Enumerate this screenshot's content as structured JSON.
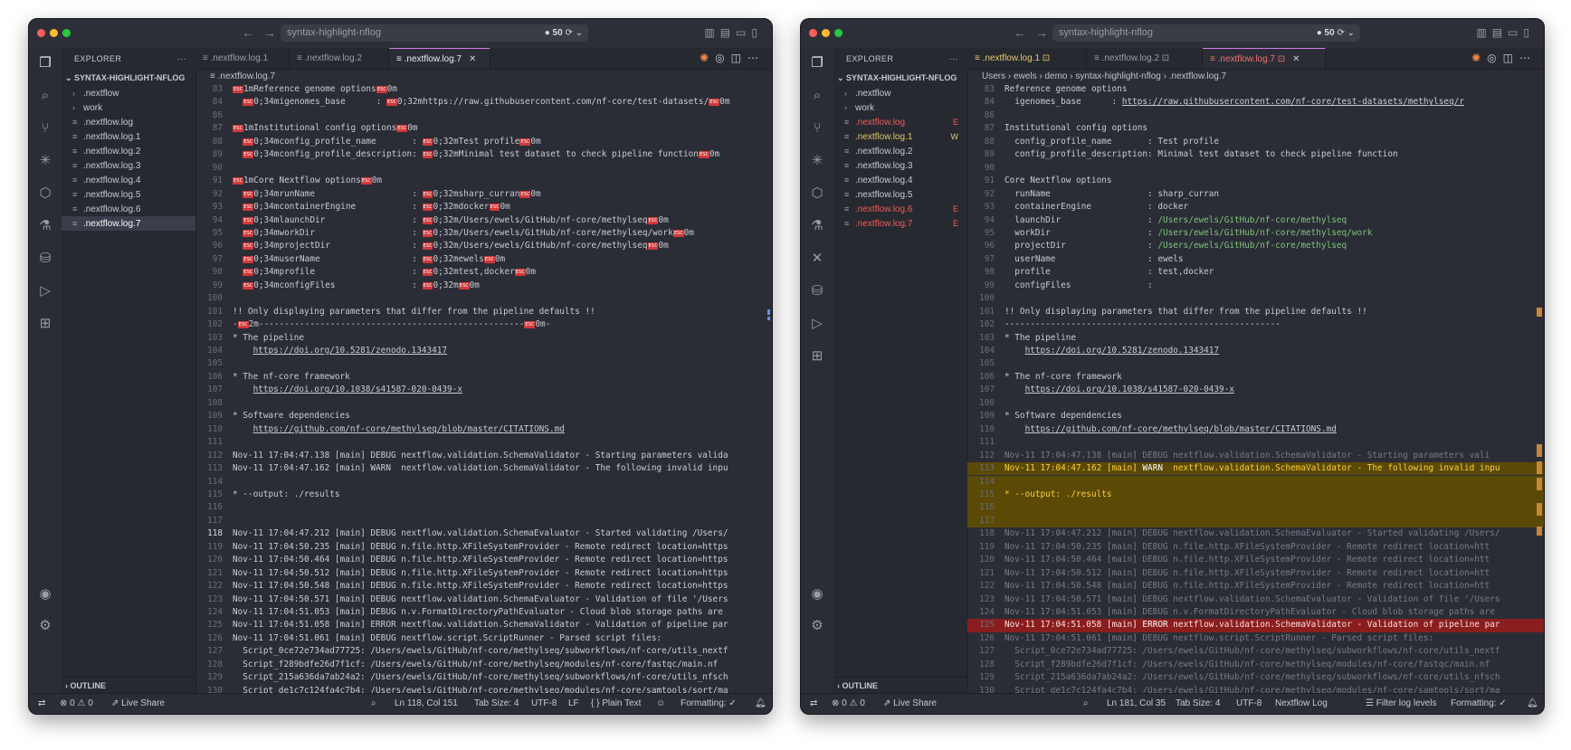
{
  "left": {
    "title": "syntax-highlight-nflog",
    "count": "50",
    "sidebar": {
      "header": "EXPLORER",
      "root": "SYNTAX-HIGHLIGHT-NFLOG",
      "items": [
        {
          "label": ".nextflow",
          "kind": "folder",
          "badge": ""
        },
        {
          "label": "work",
          "kind": "folder",
          "badge": ""
        },
        {
          "label": ".nextflow.log",
          "kind": "file",
          "badge": ""
        },
        {
          "label": ".nextflow.log.1",
          "kind": "file",
          "badge": ""
        },
        {
          "label": ".nextflow.log.2",
          "kind": "file",
          "badge": ""
        },
        {
          "label": ".nextflow.log.3",
          "kind": "file",
          "badge": ""
        },
        {
          "label": ".nextflow.log.4",
          "kind": "file",
          "badge": ""
        },
        {
          "label": ".nextflow.log.5",
          "kind": "file",
          "badge": ""
        },
        {
          "label": ".nextflow.log.6",
          "kind": "file",
          "badge": ""
        },
        {
          "label": ".nextflow.log.7",
          "kind": "file",
          "badge": ""
        }
      ],
      "outline": "OUTLINE"
    },
    "tabs": [
      ".nextflow.log.1",
      ".nextflow.log.2",
      ".nextflow.log.7"
    ],
    "breadcrumb": ".nextflow.log.7",
    "status": {
      "errors": "0",
      "warnings": "0",
      "live_share": "Live Share",
      "position": "Ln 118, Col 151",
      "tab_size": "Tab Size: 4",
      "encoding": "UTF-8",
      "eol": "LF",
      "language": "{ } Plain Text",
      "formatting": "Formatting: ✓"
    },
    "lines": [
      {
        "n": "83",
        "t": "⟪1mReference genome options⟪0m"
      },
      {
        "n": "84",
        "t": "  ⟪0;34migenomes_base      : ⟪0;32mhttps://raw.githubusercontent.com/nf-core/test-datasets/⟪0m"
      },
      {
        "n": "86",
        "t": ""
      },
      {
        "n": "87",
        "t": "⟪1mInstitutional config options⟪0m"
      },
      {
        "n": "88",
        "t": "  ⟪0;34mconfig_profile_name       : ⟪0;32mTest profile⟪0m"
      },
      {
        "n": "89",
        "t": "  ⟪0;34mconfig_profile_description: ⟪0;32mMinimal test dataset to check pipeline function⟪0m"
      },
      {
        "n": "90",
        "t": ""
      },
      {
        "n": "91",
        "t": "⟪1mCore Nextflow options⟪0m"
      },
      {
        "n": "92",
        "t": "  ⟪0;34mrunName                   : ⟪0;32msharp_curran⟪0m"
      },
      {
        "n": "93",
        "t": "  ⟪0;34mcontainerEngine           : ⟪0;32mdocker⟪0m"
      },
      {
        "n": "94",
        "t": "  ⟪0;34mlaunchDir                 : ⟪0;32m/Users/ewels/GitHub/nf-core/methylseq⟪0m"
      },
      {
        "n": "95",
        "t": "  ⟪0;34mworkDir                   : ⟪0;32m/Users/ewels/GitHub/nf-core/methylseq/work⟪0m"
      },
      {
        "n": "96",
        "t": "  ⟪0;34mprojectDir                : ⟪0;32m/Users/ewels/GitHub/nf-core/methylseq⟪0m"
      },
      {
        "n": "97",
        "t": "  ⟪0;34muserName                  : ⟪0;32mewels⟪0m"
      },
      {
        "n": "98",
        "t": "  ⟪0;34mprofile                   : ⟪0;32mtest,docker⟪0m"
      },
      {
        "n": "99",
        "t": "  ⟪0;34mconfigFiles               : ⟪0;32m⟪0m"
      },
      {
        "n": "100",
        "t": ""
      },
      {
        "n": "101",
        "t": "!! Only displaying parameters that differ from the pipeline defaults !!"
      },
      {
        "n": "102",
        "t": "-⟪2m----------------------------------------------------⟪0m-"
      },
      {
        "n": "103",
        "t": "* The pipeline"
      },
      {
        "n": "104",
        "t": "    https://doi.org/10.5281/zenodo.1343417"
      },
      {
        "n": "105",
        "t": ""
      },
      {
        "n": "106",
        "t": "* The nf-core framework"
      },
      {
        "n": "107",
        "t": "    https://doi.org/10.1038/s41587-020-0439-x"
      },
      {
        "n": "108",
        "t": ""
      },
      {
        "n": "109",
        "t": "* Software dependencies"
      },
      {
        "n": "110",
        "t": "    https://github.com/nf-core/methylseq/blob/master/CITATIONS.md"
      },
      {
        "n": "111",
        "t": ""
      },
      {
        "n": "112",
        "t": "Nov-11 17:04:47.138 [main] DEBUG nextflow.validation.SchemaValidator - Starting parameters valida"
      },
      {
        "n": "113",
        "t": "Nov-11 17:04:47.162 [main] WARN  nextflow.validation.SchemaValidator - The following invalid inpu"
      },
      {
        "n": "114",
        "t": ""
      },
      {
        "n": "115",
        "t": "* --output: ./results"
      },
      {
        "n": "116",
        "t": ""
      },
      {
        "n": "117",
        "t": ""
      },
      {
        "n": "118",
        "t": "Nov-11 17:04:47.212 [main] DEBUG nextflow.validation.SchemaEvaluator - Started validating /Users/"
      },
      {
        "n": "119",
        "t": "Nov-11 17:04:50.235 [main] DEBUG n.file.http.XFileSystemProvider - Remote redirect location=https"
      },
      {
        "n": "120",
        "t": "Nov-11 17:04:50.464 [main] DEBUG n.file.http.XFileSystemProvider - Remote redirect location=https"
      },
      {
        "n": "121",
        "t": "Nov-11 17:04:50.512 [main] DEBUG n.file.http.XFileSystemProvider - Remote redirect location=https"
      },
      {
        "n": "122",
        "t": "Nov-11 17:04:50.548 [main] DEBUG n.file.http.XFileSystemProvider - Remote redirect location=https"
      },
      {
        "n": "123",
        "t": "Nov-11 17:04:50.571 [main] DEBUG nextflow.validation.SchemaEvaluator - Validation of file '/Users"
      },
      {
        "n": "124",
        "t": "Nov-11 17:04:51.053 [main] DEBUG n.v.FormatDirectoryPathEvaluator - Cloud blob storage paths are"
      },
      {
        "n": "125",
        "t": "Nov-11 17:04:51.058 [main] ERROR nextflow.validation.SchemaValidator - Validation of pipeline par"
      },
      {
        "n": "126",
        "t": "Nov-11 17:04:51.061 [main] DEBUG nextflow.script.ScriptRunner - Parsed script files:"
      },
      {
        "n": "127",
        "t": "  Script_0ce72e734ad77725: /Users/ewels/GitHub/nf-core/methylseq/subworkflows/nf-core/utils_nextf"
      },
      {
        "n": "128",
        "t": "  Script_f289bdfe26d7f1cf: /Users/ewels/GitHub/nf-core/methylseq/modules/nf-core/fastqc/main.nf"
      },
      {
        "n": "129",
        "t": "  Script_215a636da7ab24a2: /Users/ewels/GitHub/nf-core/methylseq/subworkflows/nf-core/utils_nfsch"
      },
      {
        "n": "130",
        "t": "  Script_de1c7c124fa4c7b4: /Users/ewels/GitHub/nf-core/methylseq/modules/nf-core/samtools/sort/ma"
      }
    ]
  },
  "right": {
    "title": "syntax-highlight-nflog",
    "count": "50",
    "sidebar": {
      "header": "EXPLORER",
      "root": "SYNTAX-HIGHLIGHT-NFLOG",
      "items": [
        {
          "label": ".nextflow",
          "kind": "folder",
          "badge": ""
        },
        {
          "label": "work",
          "kind": "folder",
          "badge": ""
        },
        {
          "label": ".nextflow.log",
          "kind": "err",
          "badge": "E"
        },
        {
          "label": ".nextflow.log.1",
          "kind": "warn",
          "badge": "W"
        },
        {
          "label": ".nextflow.log.2",
          "kind": "file",
          "badge": ""
        },
        {
          "label": ".nextflow.log.3",
          "kind": "file",
          "badge": ""
        },
        {
          "label": ".nextflow.log.4",
          "kind": "file",
          "badge": ""
        },
        {
          "label": ".nextflow.log.5",
          "kind": "file",
          "badge": ""
        },
        {
          "label": ".nextflow.log.6",
          "kind": "err",
          "badge": "E"
        },
        {
          "label": ".nextflow.log.7",
          "kind": "err",
          "badge": "E"
        }
      ],
      "outline": "OUTLINE"
    },
    "tabs": [
      ".nextflow.log.1",
      ".nextflow.log.2",
      ".nextflow.log.7"
    ],
    "breadcrumb": "Users › ewels › demo › syntax-highlight-nflog › .nextflow.log.7",
    "status": {
      "errors": "0",
      "warnings": "0",
      "live_share": "Live Share",
      "position": "Ln 181, Col 35",
      "tab_size": "Tab Size: 4",
      "encoding": "UTF-8",
      "language": "Nextflow Log",
      "filter": "Filter log levels",
      "formatting": "Formatting: ✓"
    },
    "lines": [
      {
        "n": "83",
        "t": "Reference genome options"
      },
      {
        "n": "84",
        "t": "  igenomes_base      : https://raw.githubusercontent.com/nf-core/test-datasets/methylseq/r"
      },
      {
        "n": "86",
        "t": ""
      },
      {
        "n": "87",
        "t": "Institutional config options"
      },
      {
        "n": "88",
        "t": "  config_profile_name       : Test profile"
      },
      {
        "n": "89",
        "t": "  config_profile_description: Minimal test dataset to check pipeline function"
      },
      {
        "n": "90",
        "t": ""
      },
      {
        "n": "91",
        "t": "Core Nextflow options"
      },
      {
        "n": "92",
        "t": "  runName                   : sharp_curran"
      },
      {
        "n": "93",
        "t": "  containerEngine           : docker"
      },
      {
        "n": "94",
        "t": "  launchDir                 : /Users/ewels/GitHub/nf-core/methylseq"
      },
      {
        "n": "95",
        "t": "  workDir                   : /Users/ewels/GitHub/nf-core/methylseq/work"
      },
      {
        "n": "96",
        "t": "  projectDir                : /Users/ewels/GitHub/nf-core/methylseq"
      },
      {
        "n": "97",
        "t": "  userName                  : ewels"
      },
      {
        "n": "98",
        "t": "  profile                   : test,docker"
      },
      {
        "n": "99",
        "t": "  configFiles               :"
      },
      {
        "n": "100",
        "t": ""
      },
      {
        "n": "101",
        "t": "!! Only displaying parameters that differ from the pipeline defaults !!"
      },
      {
        "n": "102",
        "t": "------------------------------------------------------"
      },
      {
        "n": "103",
        "t": "* The pipeline"
      },
      {
        "n": "104",
        "t": "    https://doi.org/10.5281/zenodo.1343417"
      },
      {
        "n": "105",
        "t": ""
      },
      {
        "n": "106",
        "t": "* The nf-core framework"
      },
      {
        "n": "107",
        "t": "    https://doi.org/10.1038/s41587-020-0439-x"
      },
      {
        "n": "108",
        "t": ""
      },
      {
        "n": "109",
        "t": "* Software dependencies"
      },
      {
        "n": "110",
        "t": "    https://github.com/nf-core/methylseq/blob/master/CITATIONS.md"
      },
      {
        "n": "111",
        "t": ""
      },
      {
        "n": "112",
        "t": "Nov-11 17:04:47.138 [main] DEBUG nextflow.validation.SchemaValidator - Starting parameters vali"
      },
      {
        "n": "113",
        "t": "Nov-11 17:04:47.162 [main] WARN  nextflow.validation.SchemaValidator - The following invalid inpu"
      },
      {
        "n": "114",
        "t": ""
      },
      {
        "n": "115",
        "t": "* --output: ./results"
      },
      {
        "n": "116",
        "t": ""
      },
      {
        "n": "117",
        "t": ""
      },
      {
        "n": "118",
        "t": "Nov-11 17:04:47.212 [main] DEBUG nextflow.validation.SchemaEvaluator - Started validating /Users/"
      },
      {
        "n": "119",
        "t": "Nov-11 17:04:50.235 [main] DEBUG n.file.http.XFileSystemProvider - Remote redirect location=htt"
      },
      {
        "n": "120",
        "t": "Nov-11 17:04:50.464 [main] DEBUG n.file.http.XFileSystemProvider - Remote redirect location=htt"
      },
      {
        "n": "121",
        "t": "Nov-11 17:04:50.512 [main] DEBUG n.file.http.XFileSystemProvider - Remote redirect location=htt"
      },
      {
        "n": "122",
        "t": "Nov-11 17:04:50.548 [main] DEBUG n.file.http.XFileSystemProvider - Remote redirect location=htt"
      },
      {
        "n": "123",
        "t": "Nov-11 17:04:50.571 [main] DEBUG nextflow.validation.SchemaEvaluator - Validation of file '/Users"
      },
      {
        "n": "124",
        "t": "Nov-11 17:04:51.053 [main] DEBUG n.v.FormatDirectoryPathEvaluator - Cloud blob storage paths are"
      },
      {
        "n": "125",
        "t": "Nov-11 17:04:51.058 [main] ERROR nextflow.validation.SchemaValidator - Validation of pipeline par"
      },
      {
        "n": "126",
        "t": "Nov-11 17:04:51.061 [main] DEBUG nextflow.script.ScriptRunner - Parsed script files:"
      },
      {
        "n": "127",
        "t": "  Script_0ce72e734ad77725: /Users/ewels/GitHub/nf-core/methylseq/subworkflows/nf-core/utils_nextf"
      },
      {
        "n": "128",
        "t": "  Script_f289bdfe26d7f1cf: /Users/ewels/GitHub/nf-core/methylseq/modules/nf-core/fastqc/main.nf"
      },
      {
        "n": "129",
        "t": "  Script_215a636da7ab24a2: /Users/ewels/GitHub/nf-core/methylseq/subworkflows/nf-core/utils_nfsch"
      },
      {
        "n": "130",
        "t": "  Script_de1c7c124fa4c7b4: /Users/ewels/GitHub/nf-core/methylseq/modules/nf-core/samtools/sort/ma"
      }
    ]
  }
}
